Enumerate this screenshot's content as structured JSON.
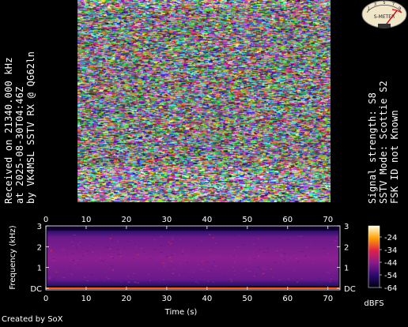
{
  "rx_info": {
    "line1": "Received on  21340.000 kHz",
    "line2": "at 2025-08-30T04:46Z",
    "line3": "by VK4MSL SSTV RX @ QG62ln"
  },
  "decode_info": {
    "line1": "Signal strength: S8",
    "line2": "SSTV Mode: Scottie S2",
    "line3": "FSK ID not Known"
  },
  "s_meter": {
    "label": "S-METER",
    "scale": [
      "1",
      "3",
      "5",
      "7",
      "9"
    ],
    "needle_level": 0.8
  },
  "spectrogram": {
    "x_axis_label": "Time (s)",
    "y_axis_label": "Frequency (kHz)",
    "x_ticks": [
      "0",
      "10",
      "20",
      "30",
      "40",
      "50",
      "60",
      "70"
    ],
    "y_ticks_left": [
      "DC",
      "1",
      "2",
      "3"
    ],
    "y_ticks_right": [
      "DC",
      "1",
      "2",
      "3"
    ],
    "colorbar_ticks": [
      "-24",
      "-34",
      "-44",
      "-54",
      "-64"
    ],
    "colorbar_unit": "dBFS"
  },
  "credit": "Created by SoX",
  "colors": {
    "background": "#000000",
    "spectrogram_band": "#7a1a8a",
    "noise_floor": "#3a0a6a",
    "dc_line": "#ff5a00"
  }
}
